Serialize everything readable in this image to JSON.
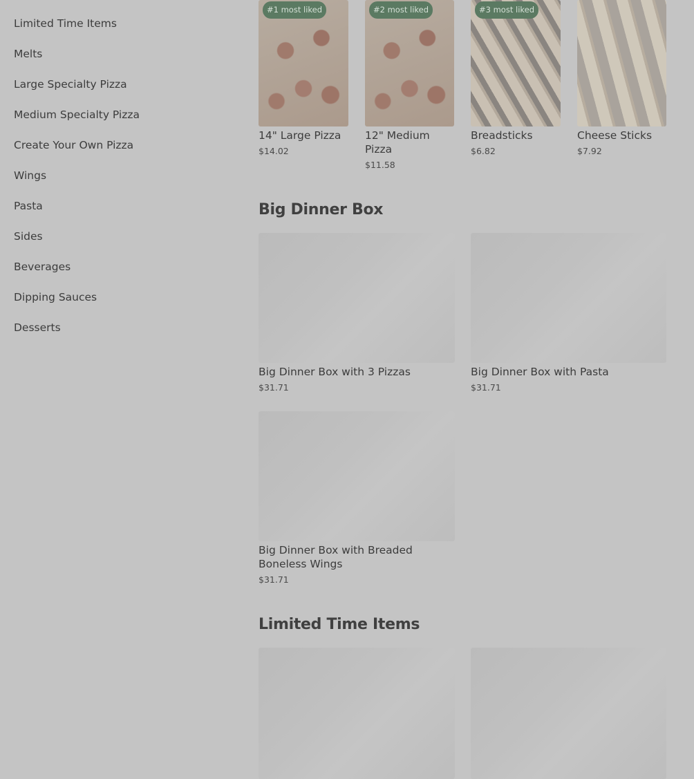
{
  "sidebar": {
    "items": [
      {
        "label": "Limited Time Items"
      },
      {
        "label": "Melts"
      },
      {
        "label": "Large Specialty Pizza"
      },
      {
        "label": "Medium Specialty Pizza"
      },
      {
        "label": "Create Your Own Pizza"
      },
      {
        "label": "Wings"
      },
      {
        "label": "Pasta"
      },
      {
        "label": "Sides"
      },
      {
        "label": "Beverages"
      },
      {
        "label": "Dipping Sauces"
      },
      {
        "label": "Desserts"
      }
    ]
  },
  "popular": {
    "items": [
      {
        "badge": "#1 most liked",
        "name": "14\" Large Pizza",
        "price": "$14.02",
        "image": "pizza"
      },
      {
        "badge": "#2 most liked",
        "name": "12\" Medium Pizza",
        "price": "$11.58",
        "image": "pizza"
      },
      {
        "badge": "#3 most liked",
        "name": "Breadsticks",
        "price": "$6.82",
        "image": "breadsticks"
      },
      {
        "badge": "",
        "name": "Cheese Sticks",
        "price": "$7.92",
        "image": "cheese-sticks"
      }
    ]
  },
  "big_dinner_box": {
    "title": "Big Dinner Box",
    "items": [
      {
        "name": "Big Dinner Box with 3 Pizzas",
        "price": "$31.71"
      },
      {
        "name": "Big Dinner Box with Pasta",
        "price": "$31.71"
      },
      {
        "name": "Big Dinner Box with Breaded Boneless Wings",
        "price": "$31.71"
      }
    ]
  },
  "limited_time": {
    "title": "Limited Time Items"
  },
  "colors": {
    "overlay": "#c4c4c4",
    "badge": "#5b7a62",
    "text": "#3c3c3c"
  }
}
